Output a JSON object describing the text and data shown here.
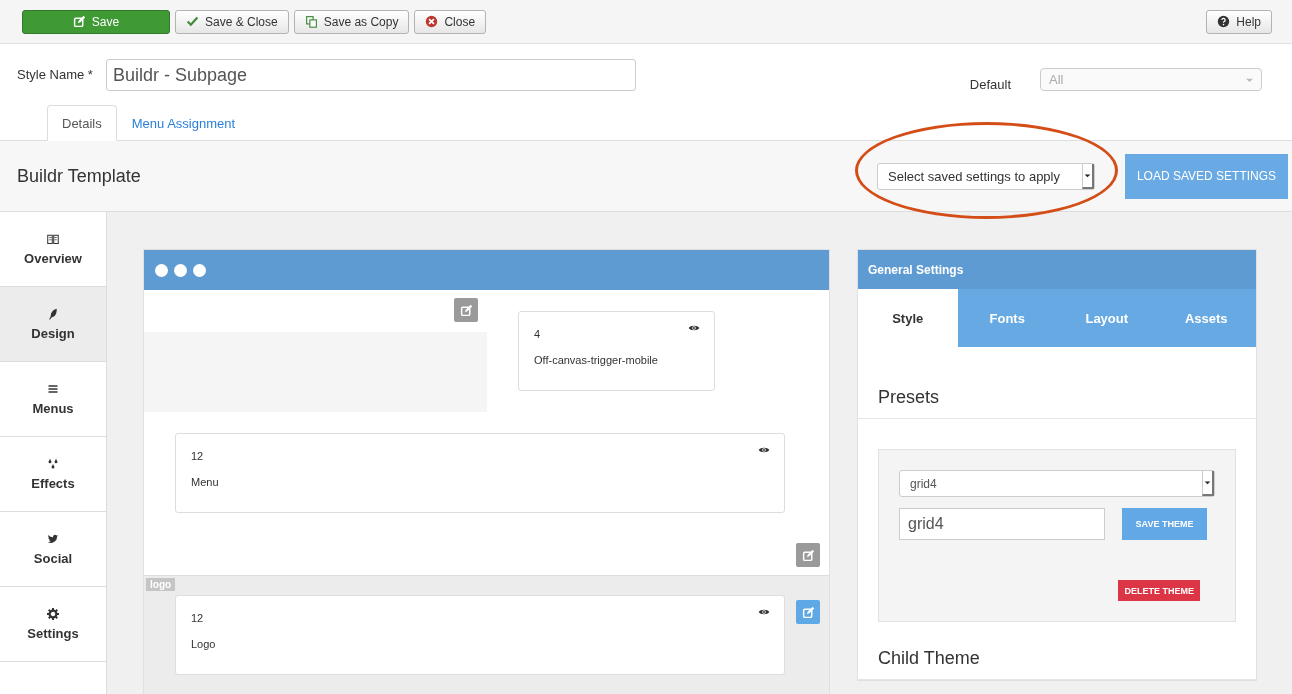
{
  "toolbar": {
    "buttons": [
      {
        "label": "Save",
        "kind": "primary"
      },
      {
        "label": "Save & Close",
        "kind": "default"
      },
      {
        "label": "Save as Copy",
        "kind": "default"
      },
      {
        "label": "Close",
        "kind": "default"
      }
    ],
    "help": {
      "label": "Help"
    }
  },
  "form": {
    "style_name": {
      "label": "Style Name *",
      "value": "Buildr - Subpage"
    },
    "default": {
      "label": "Default",
      "value": "All",
      "disabled": true
    }
  },
  "tabs": [
    {
      "label": "Details",
      "selected": true
    },
    {
      "label": "Menu Assignment",
      "selected": false
    }
  ],
  "header": {
    "title": "Buildr Template",
    "saved_settings": {
      "placeholder": "Select saved settings to apply",
      "annotated": true
    },
    "load_button": "LOAD SAVED SETTINGS"
  },
  "sidebar": {
    "items": [
      {
        "label": "Overview",
        "selected": false
      },
      {
        "label": "Design",
        "selected": true
      },
      {
        "label": "Menus",
        "selected": false
      },
      {
        "label": "Effects",
        "selected": false
      },
      {
        "label": "Social",
        "selected": false
      },
      {
        "label": "Settings",
        "selected": false
      }
    ]
  },
  "preview": {
    "sections": [
      {
        "highlighted": false,
        "rows": [
          {
            "kind": "split",
            "modules": [
              {
                "size": "4",
                "name": "Off-canvas-trigger-mobile"
              }
            ]
          },
          {
            "kind": "full",
            "modules": [
              {
                "size": "12",
                "name": "Menu"
              }
            ]
          }
        ]
      },
      {
        "label": "logo",
        "highlighted": true,
        "rows": [
          {
            "kind": "full",
            "modules": [
              {
                "size": "12",
                "name": "Logo"
              }
            ]
          }
        ]
      }
    ]
  },
  "settings": {
    "title": "General Settings",
    "tabs": [
      {
        "label": "Style",
        "selected": true
      },
      {
        "label": "Fonts",
        "selected": false
      },
      {
        "label": "Layout",
        "selected": false
      },
      {
        "label": "Assets",
        "selected": false
      }
    ],
    "presets": {
      "title": "Presets",
      "select_value": "grid4",
      "name_value": "grid4",
      "save_button": "SAVE THEME",
      "delete_button": "DELETE THEME"
    },
    "child_theme": {
      "title": "Child Theme"
    }
  }
}
